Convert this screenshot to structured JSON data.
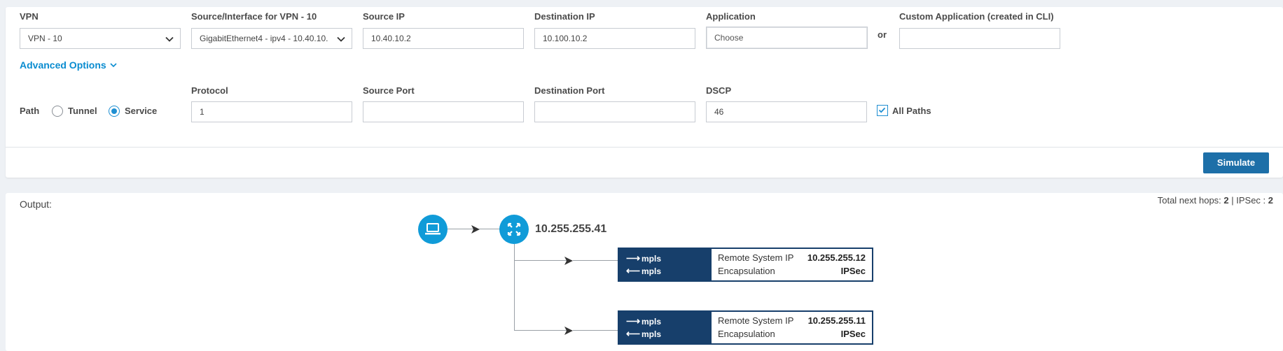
{
  "form": {
    "vpn": {
      "label": "VPN",
      "value": "VPN - 10"
    },
    "source_interface": {
      "label": "Source/Interface for VPN - 10",
      "value": "GigabitEthernet4 - ipv4 - 10.40.10."
    },
    "source_ip": {
      "label": "Source IP",
      "value": "10.40.10.2"
    },
    "destination_ip": {
      "label": "Destination IP",
      "value": "10.100.10.2"
    },
    "application": {
      "label": "Application",
      "placeholder": "Choose"
    },
    "or_text": "or",
    "custom_application": {
      "label": "Custom Application (created in CLI)",
      "value": ""
    },
    "advanced_options": "Advanced Options",
    "path": {
      "label": "Path",
      "options": [
        {
          "label": "Tunnel",
          "selected": false
        },
        {
          "label": "Service",
          "selected": true
        }
      ]
    },
    "protocol": {
      "label": "Protocol",
      "value": "1"
    },
    "source_port": {
      "label": "Source Port",
      "value": ""
    },
    "destination_port": {
      "label": "Destination Port",
      "value": ""
    },
    "dscp": {
      "label": "DSCP",
      "value": "46"
    },
    "all_paths": {
      "label": "All Paths",
      "checked": true
    },
    "simulate_label": "Simulate"
  },
  "output": {
    "label": "Output:",
    "summary": {
      "hops_text": "Total next hops: ",
      "hops_value": "2",
      "sep": " | IPSec : ",
      "ipsec_value": "2"
    },
    "router_ip": "10.255.255.41",
    "hops": [
      {
        "out_color": "mpls",
        "in_color": "mpls",
        "remote_label": "Remote System IP",
        "remote_ip": "10.255.255.12",
        "encap_label": "Encapsulation",
        "encap_value": "IPSec"
      },
      {
        "out_color": "mpls",
        "in_color": "mpls",
        "remote_label": "Remote System IP",
        "remote_ip": "10.255.255.11",
        "encap_label": "Encapsulation",
        "encap_value": "IPSec"
      }
    ]
  },
  "colors": {
    "accent": "#0a8cd0",
    "button": "#1d6fa8",
    "node": "#109bd8",
    "hop_card": "#173f6b"
  },
  "icons": [
    "chevron-down-icon",
    "laptop-icon",
    "router-icon",
    "arrow-right-icon",
    "arrow-left-icon",
    "checkbox-check-icon"
  ]
}
